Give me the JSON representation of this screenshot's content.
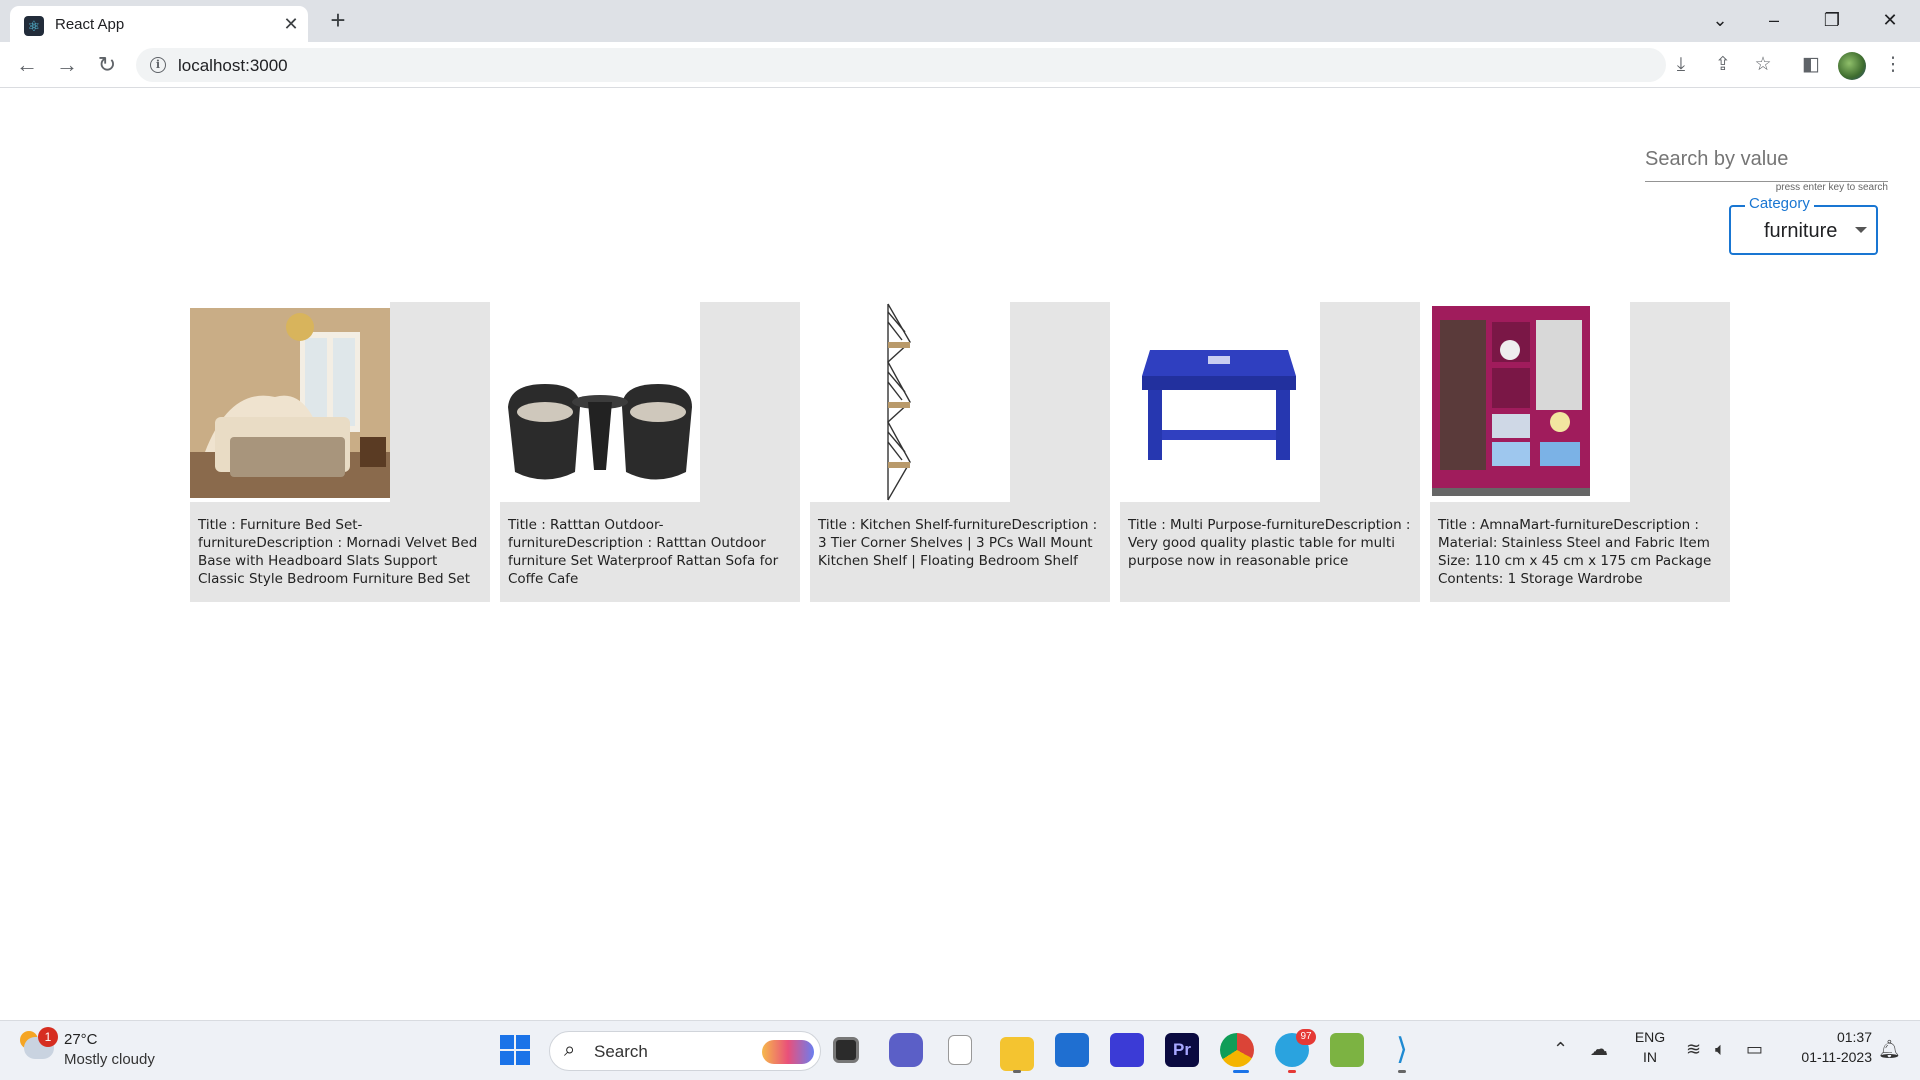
{
  "browser": {
    "tab_title": "React App",
    "url": "localhost:3000"
  },
  "search": {
    "placeholder": "Search by value",
    "hint": "press enter key to search"
  },
  "category": {
    "label": "Category",
    "value": "furniture"
  },
  "products": [
    {
      "text": "Title : Furniture Bed Set-furnitureDescription : Mornadi Velvet Bed Base with Headboard Slats Support Classic Style Bedroom Furniture Bed Set"
    },
    {
      "text": "Title : Ratttan Outdoor-furnitureDescription : Ratttan Outdoor furniture Set Waterproof Rattan Sofa for Coffe Cafe"
    },
    {
      "text": "Title : Kitchen Shelf-furnitureDescription : 3 Tier Corner Shelves | 3 PCs Wall Mount Kitchen Shelf | Floating Bedroom Shelf"
    },
    {
      "text": "Title : Multi Purpose-furnitureDescription : Very good quality plastic table for multi purpose now in reasonable price"
    },
    {
      "text": "Title : AmnaMart-furnitureDescription : Material: Stainless Steel and Fabric Item Size: 110 cm x 45 cm x 175 cm Package Contents: 1 Storage Wardrobe"
    }
  ],
  "taskbar": {
    "weather_badge": "1",
    "temperature": "27°C",
    "weather": "Mostly cloudy",
    "search_label": "Search",
    "telegram_badge": "97",
    "lang_top": "ENG",
    "lang_bottom": "IN",
    "time": "01:37",
    "date": "01-11-2023"
  }
}
